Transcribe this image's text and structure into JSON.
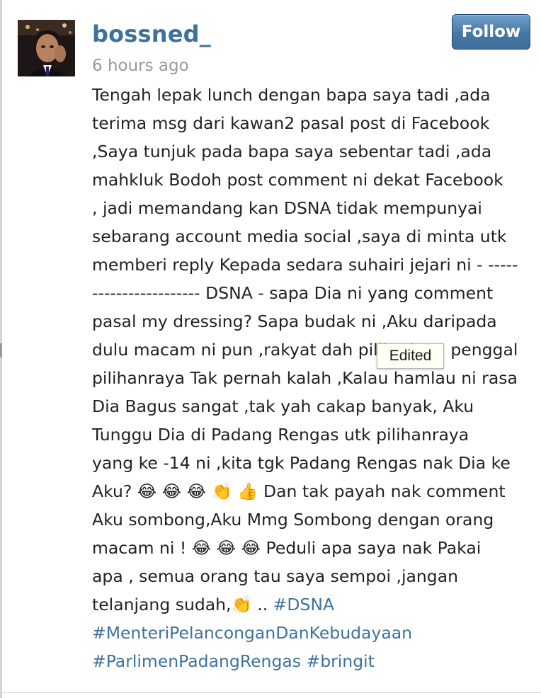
{
  "post": {
    "username": "bossned_",
    "timestamp": "6 hours ago",
    "follow_label": "Follow",
    "caption_lines": [
      "Tengah lepak lunch dengan bapa saya tadi ,ada",
      "terima msg dari kawan2 pasal post di Facebook",
      ",Saya tunjuk pada bapa saya sebentar tadi ,ada",
      "mahkluk Bodoh post comment ni dekat Facebook",
      ", jadi memandang kan DSNA tidak mempunyai",
      "sebarang account media social ,saya di minta utk",
      "memberi reply Kepada sedara suhairi jejari ni - -----",
      "------------------ DSNA - sapa Dia ni yang comment",
      "pasal my dressing? Sapa budak ni ,Aku daripada",
      "dulu macam ni pun ,rakyat dah pilih Aku 5 penggal",
      "pilihanraya Tak pernah kalah ,Kalau hamlau ni rasa",
      "Dia Bagus sangat ,tak yah cakap banyak, Aku",
      "Tunggu Dia di Padang Rengas utk pilihanraya",
      "yang ke -14 ni ,kita tgk Padang Rengas nak Dia ke",
      "Aku? 😂 😂 😂 👏 👍  Dan tak payah nak comment",
      "Aku sombong,Aku Mmg Sombong dengan orang",
      "macam ni ! 😂 😂 😂  Peduli apa saya nak Pakai",
      "apa , semua orang tau saya sempoi ,jangan",
      "telanjang sudah,👏  .. ",
      "",
      ""
    ],
    "hashtags": {
      "dsna": "#DSNA",
      "menteri": "#MenteriPelanconganDanKebudayaan",
      "parlimen": "#ParlimenPadangRengas",
      "bringit": "#bringit"
    }
  },
  "tooltip": {
    "text": "Edited"
  },
  "colors": {
    "link": "#3f729b",
    "muted": "#999999",
    "follow_button": "#4f7fac"
  },
  "icons": {
    "avatar": "profile-photo"
  }
}
